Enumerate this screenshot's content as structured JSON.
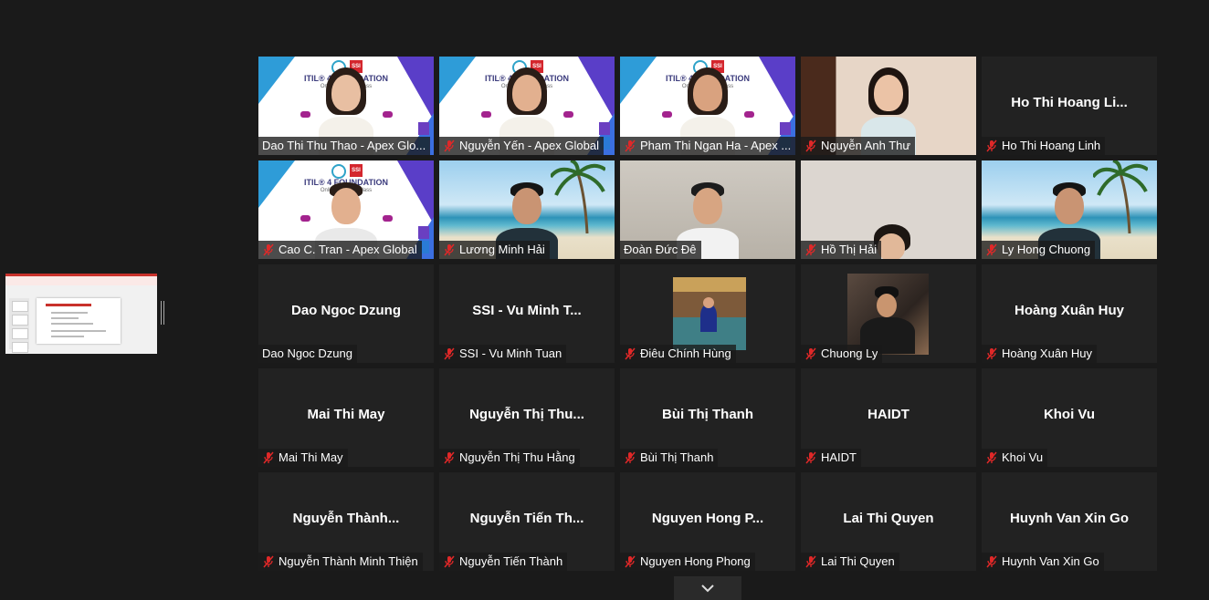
{
  "share_thumbnail": {
    "slide_title": "THÔNG TIN KHÓA ĐÀO TẠO"
  },
  "slide_background": {
    "title": "ITIL® 4 FOUNDATION",
    "subtitle": "Online - Virtual Class",
    "brand": "SSI"
  },
  "tiles": [
    {
      "row": 0,
      "col": 0,
      "label": "Dao Thi Thu Thao - Apex Glo...",
      "muted": false,
      "video": "slide",
      "person": "woman"
    },
    {
      "row": 0,
      "col": 1,
      "label": "Nguyễn Yến - Apex Global",
      "muted": true,
      "video": "slide",
      "person": "woman"
    },
    {
      "row": 0,
      "col": 2,
      "label": "Pham Thi Ngan Ha - Apex ...",
      "muted": true,
      "video": "slide",
      "person": "woman"
    },
    {
      "row": 0,
      "col": 3,
      "label": "Nguyễn Anh Thư",
      "muted": true,
      "video": "room",
      "person": "woman"
    },
    {
      "row": 0,
      "col": 4,
      "label": "Ho Thi Hoang Linh",
      "muted": true,
      "name": "Ho Thi Hoang Li..."
    },
    {
      "row": 1,
      "col": 0,
      "label": "Cao C. Tran - Apex Global",
      "muted": true,
      "video": "slide",
      "person": "man"
    },
    {
      "row": 1,
      "col": 1,
      "label": "Lương Minh Hải",
      "muted": true,
      "video": "beach",
      "person": "man"
    },
    {
      "row": 1,
      "col": 2,
      "label": "Đoàn Đức Đê",
      "muted": false,
      "video": "office",
      "person": "man"
    },
    {
      "row": 1,
      "col": 3,
      "label": "Hồ Thị Hải",
      "muted": true,
      "video": "wall",
      "person": "child"
    },
    {
      "row": 1,
      "col": 4,
      "label": "Ly Hong Chuong",
      "muted": true,
      "video": "beach",
      "person": "man"
    },
    {
      "row": 2,
      "col": 0,
      "label": "Dao Ngoc Dzung",
      "muted": false,
      "name": "Dao Ngoc Dzung",
      "active": true
    },
    {
      "row": 2,
      "col": 1,
      "label": "SSI - Vu Minh Tuan",
      "muted": true,
      "name": "SSI - Vu Minh T..."
    },
    {
      "row": 2,
      "col": 2,
      "label": "Điêu Chính Hùng",
      "muted": true,
      "avatar": "hung"
    },
    {
      "row": 2,
      "col": 3,
      "label": "Chuong Ly",
      "muted": true,
      "avatar": "chuong"
    },
    {
      "row": 2,
      "col": 4,
      "label": "Hoàng Xuân Huy",
      "muted": true,
      "name": "Hoàng Xuân Huy"
    },
    {
      "row": 3,
      "col": 0,
      "label": "Mai Thi May",
      "muted": true,
      "name": "Mai Thi May"
    },
    {
      "row": 3,
      "col": 1,
      "label": "Nguyễn Thị Thu Hằng",
      "muted": true,
      "name": "Nguyễn Thị Thu..."
    },
    {
      "row": 3,
      "col": 2,
      "label": "Bùi Thị Thanh",
      "muted": true,
      "name": "Bùi Thị Thanh"
    },
    {
      "row": 3,
      "col": 3,
      "label": "HAIDT",
      "muted": true,
      "name": "HAIDT"
    },
    {
      "row": 3,
      "col": 4,
      "label": "Khoi Vu",
      "muted": true,
      "name": "Khoi Vu"
    },
    {
      "row": 4,
      "col": 0,
      "label": "Nguyễn Thành Minh Thiện",
      "muted": true,
      "name": "Nguyễn Thành..."
    },
    {
      "row": 4,
      "col": 1,
      "label": "Nguyễn Tiến Thành",
      "muted": true,
      "name": "Nguyễn Tiến Th..."
    },
    {
      "row": 4,
      "col": 2,
      "label": "Nguyen Hong Phong",
      "muted": true,
      "name": "Nguyen Hong P..."
    },
    {
      "row": 4,
      "col": 3,
      "label": "Lai Thi Quyen",
      "muted": true,
      "name": "Lai Thi Quyen"
    },
    {
      "row": 4,
      "col": 4,
      "label": "Huynh Van Xin Go",
      "muted": true,
      "name": "Huynh Van Xin Go"
    }
  ],
  "expand_button": {
    "icon": "chevron-down-icon"
  }
}
